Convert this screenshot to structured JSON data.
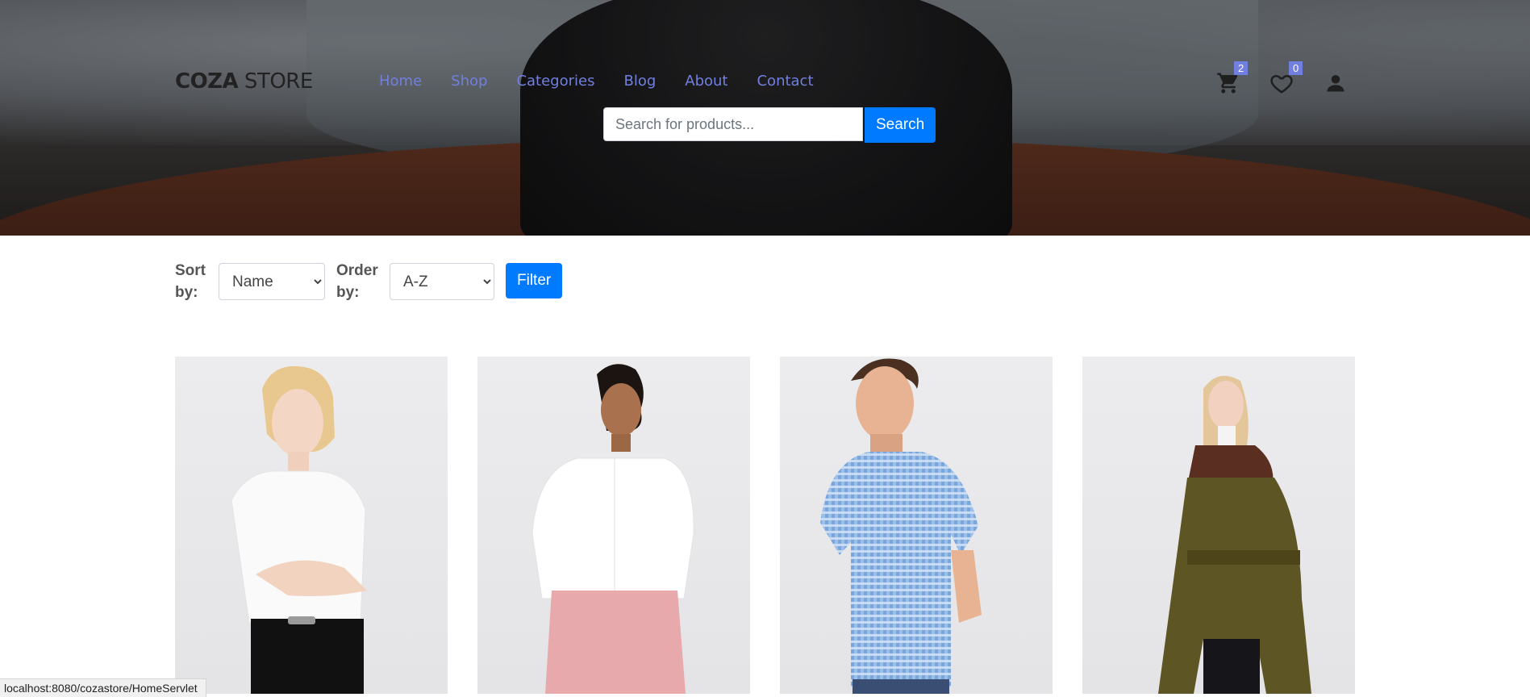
{
  "header": {
    "logo_bold": "COZA",
    "logo_light": " STORE",
    "nav": [
      "Home",
      "Shop",
      "Categories",
      "Blog",
      "About",
      "Contact"
    ],
    "search": {
      "placeholder": "Search for products...",
      "button_label": "Search"
    },
    "cart_count": "2",
    "wishlist_count": "0",
    "accent_color": "#717fe0",
    "button_color": "#007bff"
  },
  "filters": {
    "sort_label": "Sort by:",
    "sort_value": "Name",
    "order_label": "Order by:",
    "order_value": "A-Z",
    "filter_label": "Filter"
  },
  "products": [
    {
      "image": "woman-white-tshirt"
    },
    {
      "image": "woman-white-shirt-pink-pants"
    },
    {
      "image": "man-blue-checked-shirt"
    },
    {
      "image": "woman-olive-coat"
    }
  ],
  "statusbar": {
    "url": "localhost:8080/cozastore/HomeServlet"
  }
}
